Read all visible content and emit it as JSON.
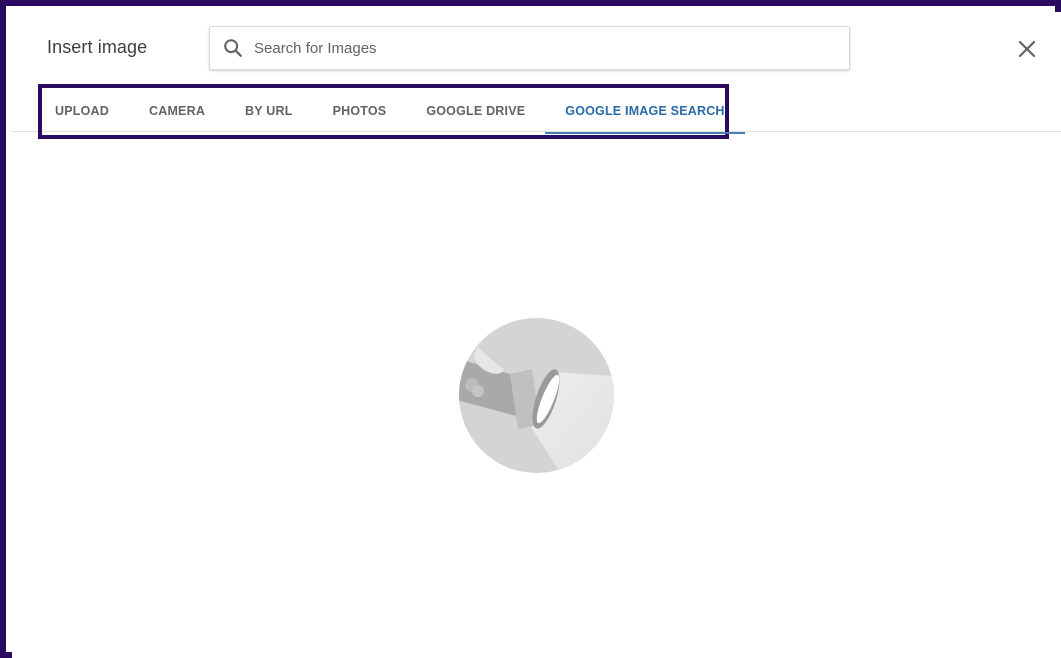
{
  "dialog": {
    "title": "Insert image",
    "close_icon": "close-icon"
  },
  "search": {
    "icon": "search-icon",
    "placeholder": "Search for Images",
    "value": ""
  },
  "tabs": [
    {
      "label": "UPLOAD",
      "active": false
    },
    {
      "label": "CAMERA",
      "active": false
    },
    {
      "label": "BY URL",
      "active": false
    },
    {
      "label": "PHOTOS",
      "active": false
    },
    {
      "label": "GOOGLE DRIVE",
      "active": false
    },
    {
      "label": "GOOGLE IMAGE SEARCH",
      "active": true
    }
  ],
  "colors": {
    "frame": "#2a0a5e",
    "active_tab": "#2b6aa8",
    "inactive_tab": "#5f6368"
  },
  "empty_state": {
    "icon": "flashlight-icon"
  }
}
